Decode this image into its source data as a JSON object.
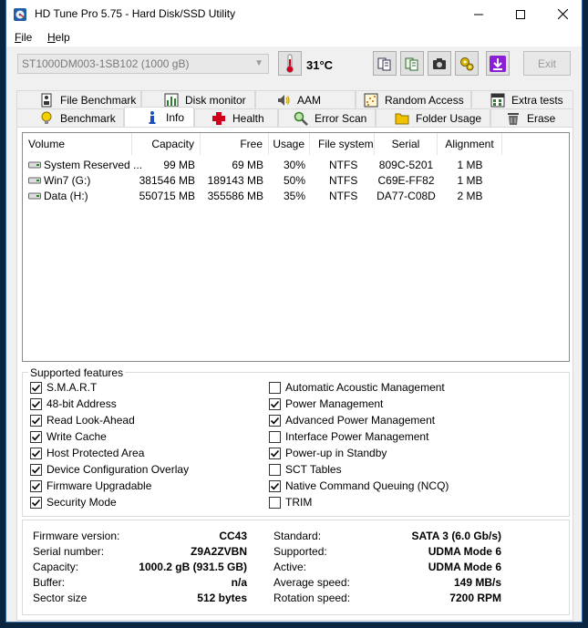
{
  "window": {
    "title": "HD Tune Pro 5.75 - Hard Disk/SSD Utility"
  },
  "menu": [
    {
      "accel": "F",
      "rest": "ile"
    },
    {
      "accel": "H",
      "rest": "elp"
    }
  ],
  "toolbar": {
    "drive": "ST1000DM003-1SB102 (1000 gB)",
    "temperature": "31°C",
    "exit_label": "Exit"
  },
  "tabs_row1": [
    "File Benchmark",
    "Disk monitor",
    "AAM",
    "Random Access",
    "Extra tests"
  ],
  "tabs_row2": [
    "Benchmark",
    "Info",
    "Health",
    "Error Scan",
    "Folder Usage",
    "Erase"
  ],
  "volumes": {
    "headers": [
      "Volume",
      "Capacity",
      "Free",
      "Usage",
      "File system",
      "Serial",
      "Alignment"
    ],
    "rows": [
      [
        "System Reserved ...",
        "99 MB",
        "69 MB",
        "30%",
        "NTFS",
        "809C-5201",
        "1 MB"
      ],
      [
        "Win7 (G:)",
        "381546 MB",
        "189143 MB",
        "50%",
        "NTFS",
        "C69E-FF82",
        "1 MB"
      ],
      [
        "Data (H:)",
        "550715 MB",
        "355586 MB",
        "35%",
        "NTFS",
        "DA77-C08D",
        "2 MB"
      ]
    ]
  },
  "features": {
    "title": "Supported features",
    "left": [
      {
        "label": "S.M.A.R.T",
        "checked": true
      },
      {
        "label": "48-bit Address",
        "checked": true
      },
      {
        "label": "Read Look-Ahead",
        "checked": true
      },
      {
        "label": "Write Cache",
        "checked": true
      },
      {
        "label": "Host Protected Area",
        "checked": true
      },
      {
        "label": "Device Configuration Overlay",
        "checked": true
      },
      {
        "label": "Firmware Upgradable",
        "checked": true
      },
      {
        "label": "Security Mode",
        "checked": true
      }
    ],
    "right": [
      {
        "label": "Automatic Acoustic Management",
        "checked": false
      },
      {
        "label": "Power Management",
        "checked": true
      },
      {
        "label": "Advanced Power Management",
        "checked": true
      },
      {
        "label": "Interface Power Management",
        "checked": false
      },
      {
        "label": "Power-up in Standby",
        "checked": true
      },
      {
        "label": "SCT Tables",
        "checked": false
      },
      {
        "label": "Native Command Queuing (NCQ)",
        "checked": true
      },
      {
        "label": "TRIM",
        "checked": false
      }
    ]
  },
  "info": {
    "left": [
      {
        "label": "Firmware version:",
        "value": "CC43"
      },
      {
        "label": "Serial number:",
        "value": "Z9A2ZVBN"
      },
      {
        "label": "Capacity:",
        "value": "1000.2 gB (931.5 GB)"
      },
      {
        "label": "Buffer:",
        "value": "n/a"
      },
      {
        "label": "Sector size",
        "value": "512 bytes"
      }
    ],
    "right": [
      {
        "label": "Standard:",
        "value": "SATA 3 (6.0 Gb/s)"
      },
      {
        "label": "Supported:",
        "value": "UDMA Mode 6"
      },
      {
        "label": "Active:",
        "value": "UDMA Mode 6"
      },
      {
        "label": "Average speed:",
        "value": "149 MB/s"
      },
      {
        "label": "Rotation speed:",
        "value": "7200 RPM"
      }
    ]
  }
}
